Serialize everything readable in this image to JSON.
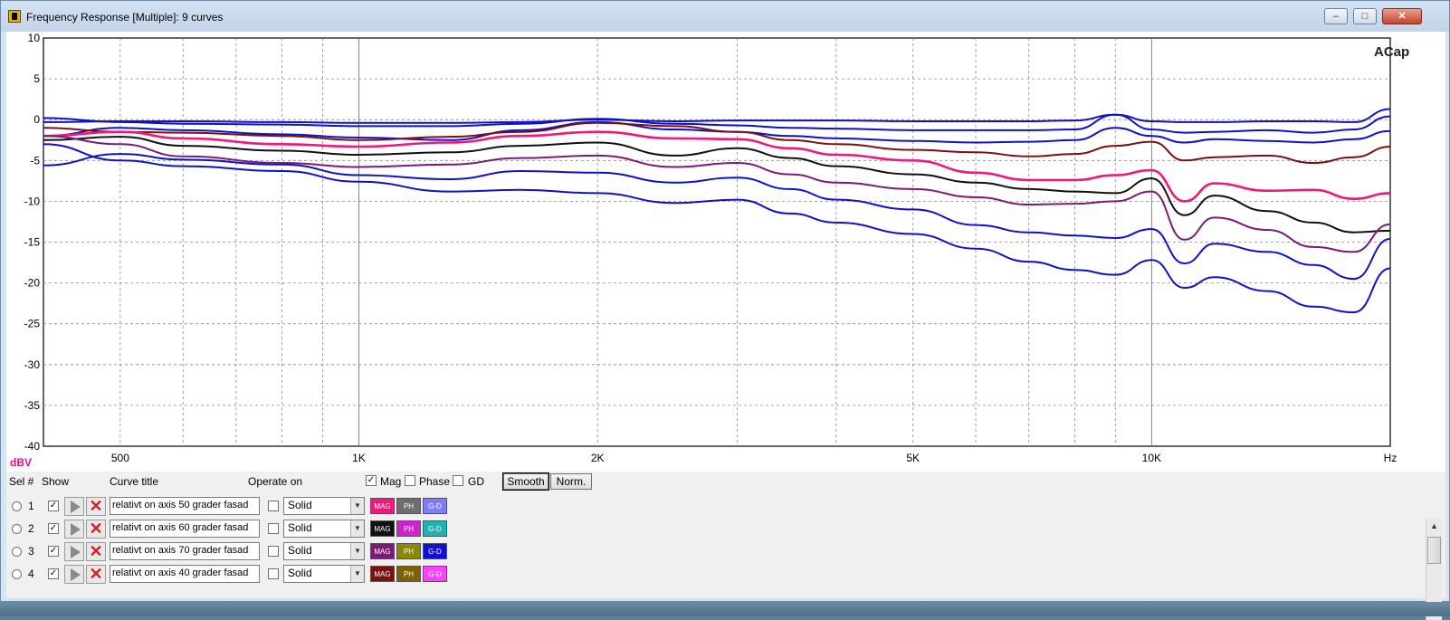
{
  "window": {
    "title": "Frequency Response [Multiple]: 9 curves",
    "buttons": [
      "–",
      "□",
      "✕"
    ]
  },
  "chart_data": {
    "type": "line",
    "title": "",
    "watermark": "ACap",
    "xlabel": "Hz",
    "ylabel": "dBV",
    "x_scale": "log",
    "xlim": [
      400,
      20000
    ],
    "ylim": [
      -40,
      10
    ],
    "x_tick_labels": [
      {
        "value": 500,
        "label": "500"
      },
      {
        "value": 1000,
        "label": "1K"
      },
      {
        "value": 2000,
        "label": "2K"
      },
      {
        "value": 5000,
        "label": "5K"
      },
      {
        "value": 10000,
        "label": "10K"
      },
      {
        "value": 20000,
        "label": "Hz"
      }
    ],
    "y_ticks": [
      10,
      5,
      0,
      -5,
      -10,
      -15,
      -20,
      -25,
      -30,
      -35,
      -40
    ],
    "y_tick_labels": [
      "10",
      "5",
      "0",
      "-5",
      "-10",
      "-15",
      "-20",
      "-25",
      "-30",
      "-35",
      "-40"
    ],
    "grid": true,
    "x": [
      400,
      500,
      600,
      800,
      1000,
      1300,
      1600,
      2000,
      2500,
      3000,
      3500,
      4000,
      5000,
      6000,
      7000,
      8000,
      9000,
      10000,
      11000,
      12000,
      14000,
      16000,
      18000,
      20000
    ],
    "series": [
      {
        "color": "#1010c8",
        "values": [
          -0.3,
          -0.2,
          -0.2,
          -0.3,
          -0.4,
          -0.4,
          -0.3,
          0.0,
          -0.2,
          -0.1,
          -0.1,
          -0.1,
          -0.2,
          -0.2,
          -0.2,
          -0.1,
          0.6,
          -0.2,
          -0.3,
          -0.3,
          -0.2,
          -0.2,
          -0.3,
          1.3
        ]
      },
      {
        "color": "#1010c8",
        "values": [
          0.2,
          -0.3,
          -0.5,
          -0.6,
          -0.8,
          -0.8,
          -0.5,
          0.1,
          -0.5,
          -0.7,
          -1.0,
          -1.1,
          -1.3,
          -1.3,
          -1.3,
          -1.2,
          0.6,
          -1.2,
          -1.6,
          -1.5,
          -1.3,
          -1.6,
          -1.2,
          0.4
        ]
      },
      {
        "color": "#1010c8",
        "values": [
          -2.0,
          -1.0,
          -1.3,
          -1.8,
          -2.2,
          -2.5,
          -1.3,
          -0.3,
          -1.2,
          -1.5,
          -2.0,
          -2.3,
          -2.6,
          -2.8,
          -2.7,
          -2.5,
          -1.0,
          -2.0,
          -2.8,
          -2.4,
          -2.6,
          -2.8,
          -2.4,
          -1.4
        ]
      },
      {
        "color": "#7a1010",
        "values": [
          -1.0,
          -1.5,
          -1.6,
          -2.0,
          -2.5,
          -2.1,
          -1.5,
          -0.4,
          -0.8,
          -1.5,
          -2.5,
          -3.0,
          -3.7,
          -4.0,
          -4.5,
          -4.2,
          -3.2,
          -2.7,
          -5.0,
          -4.6,
          -4.4,
          -5.3,
          -4.6,
          -3.3
        ]
      },
      {
        "color": "#f0187c",
        "values": [
          -2.0,
          -1.5,
          -2.3,
          -3.0,
          -3.3,
          -2.8,
          -2.0,
          -1.5,
          -2.3,
          -2.4,
          -3.5,
          -4.3,
          -5.0,
          -6.5,
          -7.4,
          -7.4,
          -6.8,
          -6.2,
          -10.0,
          -7.8,
          -8.7,
          -8.6,
          -9.7,
          -9.0
        ]
      },
      {
        "color": "#101010",
        "values": [
          -2.5,
          -2.1,
          -3.2,
          -3.8,
          -4.3,
          -4.0,
          -3.2,
          -2.8,
          -4.4,
          -3.5,
          -4.7,
          -5.7,
          -6.7,
          -7.7,
          -8.5,
          -8.8,
          -9.0,
          -7.2,
          -11.7,
          -9.3,
          -11.2,
          -12.6,
          -13.8,
          -13.6
        ]
      },
      {
        "color": "#7a1a7a",
        "values": [
          -2.0,
          -3.0,
          -4.5,
          -5.3,
          -5.8,
          -5.5,
          -4.7,
          -4.4,
          -5.8,
          -5.3,
          -6.7,
          -7.7,
          -8.5,
          -9.5,
          -10.4,
          -10.3,
          -10.0,
          -8.8,
          -14.7,
          -12.0,
          -13.5,
          -15.6,
          -16.2,
          -12.8
        ]
      },
      {
        "color": "#1010c8",
        "values": [
          -5.6,
          -4.2,
          -4.9,
          -5.5,
          -6.8,
          -7.3,
          -6.3,
          -6.5,
          -7.7,
          -7.1,
          -8.5,
          -9.8,
          -11.0,
          -12.9,
          -13.8,
          -14.2,
          -14.5,
          -13.4,
          -17.6,
          -15.2,
          -16.2,
          -17.8,
          -19.5,
          -14.6
        ]
      },
      {
        "color": "#1010c8",
        "values": [
          -3.0,
          -5.0,
          -5.7,
          -6.3,
          -7.6,
          -8.8,
          -8.6,
          -9.0,
          -10.2,
          -9.8,
          -11.5,
          -12.6,
          -14.0,
          -15.8,
          -17.4,
          -18.4,
          -19.0,
          -17.2,
          -20.6,
          -19.3,
          -21.0,
          -22.9,
          -23.6,
          -18.2
        ]
      }
    ]
  },
  "panel": {
    "col_sel": "Sel #",
    "col_show": "Show",
    "col_title": "Curve title",
    "col_operate": "Operate on",
    "chk_mag": "Mag",
    "chk_phase": "Phase",
    "chk_gd": "GD",
    "btn_smooth": "Smooth",
    "btn_norm": "Norm.",
    "check_mark": "✓",
    "rows": [
      {
        "num": "1",
        "title": "relativt on axis 50 grader fasad",
        "style": "Solid",
        "mag": "MAG",
        "ph": "PH",
        "gd": "G-D",
        "mag_color": "#f0187c",
        "ph_color": "#6e6e6e",
        "gd_color": "#7c7cff"
      },
      {
        "num": "2",
        "title": "relativt on axis 60 grader fasad",
        "style": "Solid",
        "mag": "MAG",
        "ph": "PH",
        "gd": "G-D",
        "mag_color": "#101010",
        "ph_color": "#d21fd2",
        "gd_color": "#1fb2b2"
      },
      {
        "num": "3",
        "title": "relativt on axis 70 grader fasad",
        "style": "Solid",
        "mag": "MAG",
        "ph": "PH",
        "gd": "G-D",
        "mag_color": "#7a1a7a",
        "ph_color": "#8a8a00",
        "gd_color": "#1010d0"
      },
      {
        "num": "4",
        "title": "relativt on axis 40 grader fasad",
        "style": "Solid",
        "mag": "MAG",
        "ph": "PH",
        "gd": "G-D",
        "mag_color": "#7a1010",
        "ph_color": "#806000",
        "gd_color": "#ff40ff"
      }
    ]
  }
}
